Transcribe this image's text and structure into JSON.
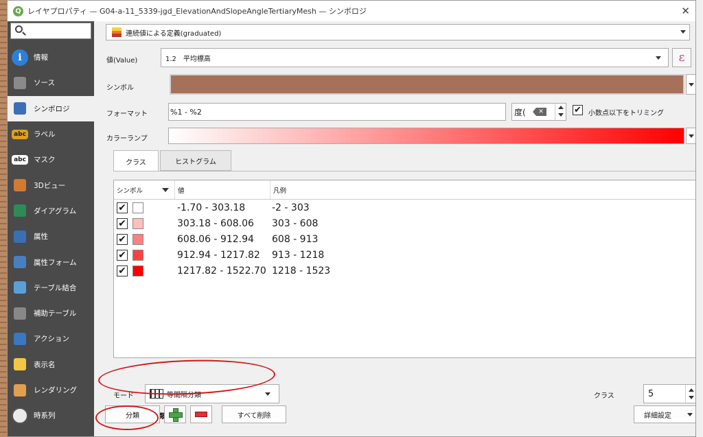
{
  "window": {
    "title": "レイヤプロパティ — G04-a-11_5339-jgd_ElevationAndSlopeAngleTertiaryMesh — シンボロジ",
    "close_glyph": "✕"
  },
  "search": {
    "placeholder": ""
  },
  "sidebar": {
    "items": [
      {
        "label": "情報",
        "icon": "info-icon"
      },
      {
        "label": "ソース",
        "icon": "wrench-icon"
      },
      {
        "label": "シンボロジ",
        "icon": "paintbrush-icon"
      },
      {
        "label": "ラベル",
        "icon": "label-abc-icon"
      },
      {
        "label": "マスク",
        "icon": "mask-abc-icon"
      },
      {
        "label": "3Dビュー",
        "icon": "cube-icon"
      },
      {
        "label": "ダイアグラム",
        "icon": "diagram-icon"
      },
      {
        "label": "属性",
        "icon": "attribute-table-icon"
      },
      {
        "label": "属性フォーム",
        "icon": "form-icon"
      },
      {
        "label": "テーブル結合",
        "icon": "join-icon"
      },
      {
        "label": "補助テーブル",
        "icon": "auxiliary-storage-icon"
      },
      {
        "label": "アクション",
        "icon": "action-icon"
      },
      {
        "label": "表示名",
        "icon": "display-tip-icon"
      },
      {
        "label": "レンダリング",
        "icon": "rendering-icon"
      },
      {
        "label": "時系列",
        "icon": "clock-icon"
      }
    ],
    "active_index": 2,
    "abc_text": "abc"
  },
  "renderer": {
    "label": "連続値による定義(graduated)"
  },
  "value_row": {
    "label": "値(Value)",
    "value": "1.2　平均標高",
    "expr_glyph": "ε"
  },
  "symbol_row": {
    "label": "シンボル",
    "color": "#a5715a"
  },
  "format_row": {
    "label": "フォーマット",
    "value": "%1 - %2",
    "precision_value": "度(",
    "trim_checked": true,
    "trim_label": "小数点以下をトリミング"
  },
  "ramp_row": {
    "label": "カラーランプ",
    "start_color": "#ffffff",
    "end_color": "#ff0000"
  },
  "tabs": {
    "classes": "クラス",
    "histogram": "ヒストグラム"
  },
  "table": {
    "columns": {
      "symbol": "シンボル",
      "value": "値",
      "legend": "凡例"
    },
    "rows": [
      {
        "checked": true,
        "color": "#ffffff",
        "value": "-1.70 - 303.18",
        "legend": "-2 - 303"
      },
      {
        "checked": true,
        "color": "#ffbfbf",
        "value": "303.18 - 608.06",
        "legend": "303 - 608"
      },
      {
        "checked": true,
        "color": "#ff8080",
        "value": "608.06 - 912.94",
        "legend": "608 - 913"
      },
      {
        "checked": true,
        "color": "#ff4040",
        "value": "912.94 - 1217.82",
        "legend": "913 - 1218"
      },
      {
        "checked": true,
        "color": "#ff0000",
        "value": "1217.82 - 1522.70",
        "legend": "1218 - 1523"
      }
    ]
  },
  "mode": {
    "label": "モード",
    "value": "等間隔分類"
  },
  "classes_count": {
    "label": "クラス",
    "value": "5"
  },
  "symmetric": {
    "label": "対称分類",
    "checked": false
  },
  "buttons": {
    "classify": "分類",
    "delete_all": "すべて削除",
    "advanced": "詳細設定"
  },
  "check_glyph": "✔",
  "annotation_color": "#d41717"
}
